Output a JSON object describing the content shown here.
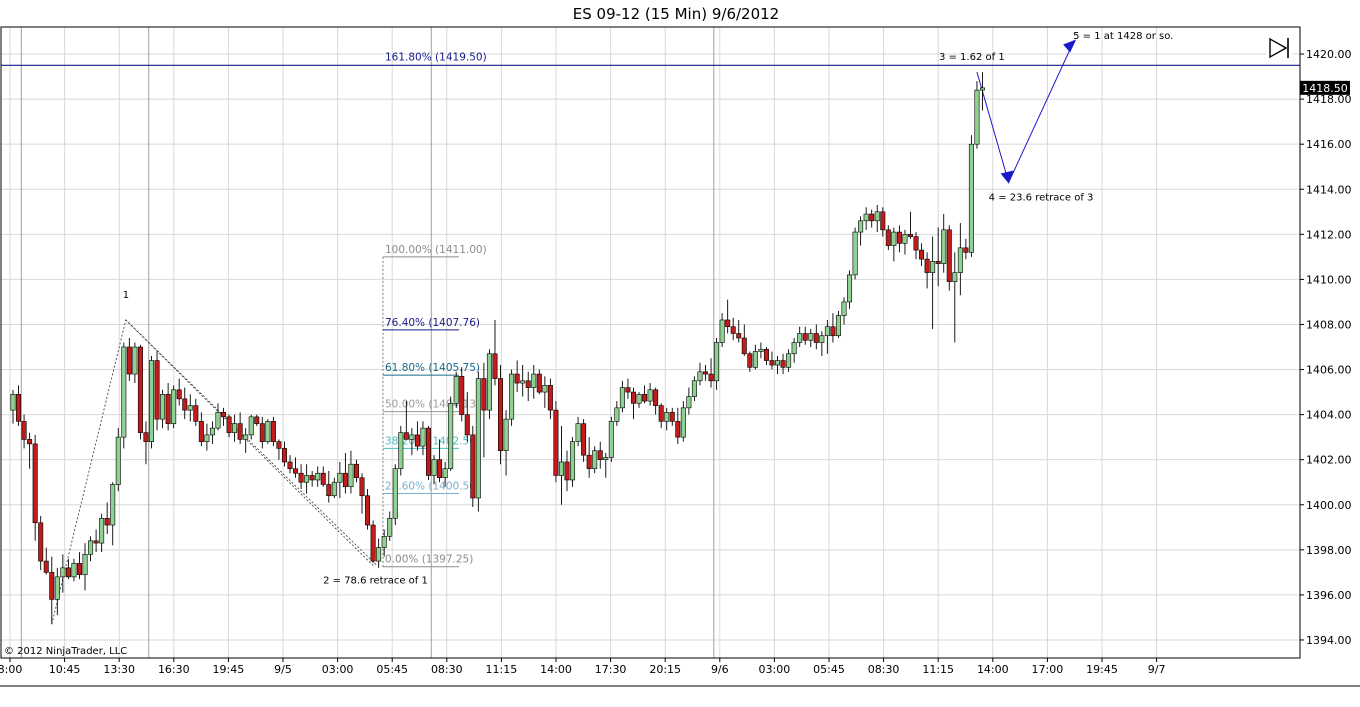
{
  "window": {
    "title": "ES 09-12 (15 Min)  9/6/2012",
    "copyright": "© 2012 NinjaTrader, LLC",
    "last_price_label": "1418.50",
    "colors": {
      "up_candle": "#90d090",
      "down_candle": "#c01c1c",
      "wick": "#000000",
      "grid": "#d8d8d8",
      "fib_line": "#8c8c8c",
      "blue_annotation": "#1a1acc",
      "price_marker_bg": "#000000"
    },
    "icons": [
      "skip-to-end-icon"
    ]
  },
  "chart_data": {
    "type": "candlestick",
    "symbol": "ES 09-12",
    "timeframe": "15 Min",
    "ylim": [
      1393.2,
      1421.2
    ],
    "y_ticks": [
      1394,
      1396,
      1398,
      1400,
      1402,
      1404,
      1406,
      1408,
      1410,
      1412,
      1414,
      1416,
      1418,
      1420
    ],
    "y_tick_labels": [
      "1394.00",
      "1396.00",
      "1398.00",
      "1400.00",
      "1402.00",
      "1404.00",
      "1406.00",
      "1408.00",
      "1410.00",
      "1412.00",
      "1414.00",
      "1416.00",
      "1418.00",
      "1420.00"
    ],
    "x_labels": [
      "8:00",
      "10:45",
      "13:30",
      "16:30",
      "19:45",
      "9/5",
      "03:00",
      "05:45",
      "08:30",
      "11:15",
      "14:00",
      "17:30",
      "20:15",
      "9/6",
      "03:00",
      "05:45",
      "08:30",
      "11:15",
      "14:00",
      "17:00",
      "19:45",
      "9/7"
    ],
    "session_dividers": [
      2,
      25,
      76,
      127
    ],
    "last_price": 1418.5,
    "candles": [
      [
        1404.2,
        1405.1,
        1403.6,
        1404.9
      ],
      [
        1404.9,
        1405.3,
        1403.5,
        1403.7
      ],
      [
        1403.7,
        1404.0,
        1402.5,
        1402.9
      ],
      [
        1402.9,
        1403.2,
        1401.6,
        1402.7
      ],
      [
        1402.7,
        1403.1,
        1398.4,
        1399.2
      ],
      [
        1399.2,
        1399.5,
        1397.1,
        1397.5
      ],
      [
        1397.5,
        1398.1,
        1396.9,
        1397.0
      ],
      [
        1397.0,
        1397.7,
        1394.7,
        1395.8
      ],
      [
        1395.8,
        1397.2,
        1395.1,
        1396.8
      ],
      [
        1396.8,
        1397.8,
        1396.1,
        1397.2
      ],
      [
        1397.2,
        1397.6,
        1396.7,
        1396.8
      ],
      [
        1396.8,
        1397.6,
        1396.6,
        1397.4
      ],
      [
        1397.4,
        1397.9,
        1396.7,
        1396.9
      ],
      [
        1396.9,
        1398.3,
        1396.2,
        1397.8
      ],
      [
        1397.8,
        1398.6,
        1397.5,
        1398.4
      ],
      [
        1398.4,
        1398.9,
        1397.9,
        1398.3
      ],
      [
        1398.3,
        1399.6,
        1397.9,
        1399.4
      ],
      [
        1399.4,
        1400.1,
        1398.7,
        1399.1
      ],
      [
        1399.1,
        1401.0,
        1398.2,
        1400.9
      ],
      [
        1400.9,
        1403.4,
        1400.6,
        1403.0
      ],
      [
        1403.0,
        1407.2,
        1402.5,
        1407.0
      ],
      [
        1407.0,
        1407.4,
        1405.5,
        1405.8
      ],
      [
        1405.8,
        1407.2,
        1405.4,
        1407.0
      ],
      [
        1407.0,
        1407.1,
        1402.9,
        1403.2
      ],
      [
        1403.2,
        1403.7,
        1401.8,
        1402.8
      ],
      [
        1402.8,
        1406.6,
        1402.5,
        1406.4
      ],
      [
        1406.4,
        1406.8,
        1403.3,
        1403.8
      ],
      [
        1403.8,
        1405.1,
        1403.4,
        1404.9
      ],
      [
        1404.9,
        1405.4,
        1403.3,
        1403.6
      ],
      [
        1403.6,
        1405.3,
        1403.4,
        1405.1
      ],
      [
        1405.1,
        1405.6,
        1404.4,
        1404.7
      ],
      [
        1404.7,
        1405.2,
        1403.8,
        1404.2
      ],
      [
        1404.2,
        1404.9,
        1403.7,
        1404.4
      ],
      [
        1404.4,
        1404.7,
        1403.5,
        1403.7
      ],
      [
        1403.7,
        1404.1,
        1402.6,
        1402.8
      ],
      [
        1402.8,
        1403.6,
        1402.4,
        1403.1
      ],
      [
        1403.1,
        1403.7,
        1402.7,
        1403.4
      ],
      [
        1403.4,
        1404.5,
        1403.3,
        1404.1
      ],
      [
        1404.1,
        1404.3,
        1403.5,
        1403.9
      ],
      [
        1403.9,
        1404.0,
        1403.0,
        1403.2
      ],
      [
        1403.2,
        1404.0,
        1402.8,
        1403.6
      ],
      [
        1403.6,
        1404.1,
        1402.7,
        1402.9
      ],
      [
        1402.9,
        1403.4,
        1402.3,
        1403.1
      ],
      [
        1403.1,
        1404.0,
        1402.9,
        1403.9
      ],
      [
        1403.9,
        1404.0,
        1403.5,
        1403.6
      ],
      [
        1403.6,
        1403.9,
        1402.5,
        1402.8
      ],
      [
        1402.8,
        1403.8,
        1402.7,
        1403.7
      ],
      [
        1403.7,
        1403.9,
        1402.6,
        1402.8
      ],
      [
        1402.8,
        1402.9,
        1402.0,
        1402.5
      ],
      [
        1402.5,
        1402.8,
        1401.7,
        1401.9
      ],
      [
        1401.9,
        1402.2,
        1401.4,
        1401.6
      ],
      [
        1401.6,
        1402.1,
        1401.2,
        1401.4
      ],
      [
        1401.4,
        1401.8,
        1400.7,
        1401.0
      ],
      [
        1401.0,
        1401.8,
        1400.5,
        1401.3
      ],
      [
        1401.3,
        1401.5,
        1400.8,
        1401.1
      ],
      [
        1401.1,
        1401.7,
        1400.8,
        1401.4
      ],
      [
        1401.4,
        1401.7,
        1400.8,
        1400.9
      ],
      [
        1400.9,
        1401.5,
        1400.1,
        1400.4
      ],
      [
        1400.4,
        1401.2,
        1400.3,
        1401.0
      ],
      [
        1401.0,
        1401.9,
        1400.3,
        1401.4
      ],
      [
        1401.4,
        1402.3,
        1400.5,
        1400.8
      ],
      [
        1400.8,
        1402.4,
        1400.5,
        1401.8
      ],
      [
        1401.8,
        1402.0,
        1401.0,
        1401.2
      ],
      [
        1401.2,
        1401.4,
        1399.6,
        1400.4
      ],
      [
        1400.4,
        1400.7,
        1398.9,
        1399.1
      ],
      [
        1399.1,
        1399.3,
        1397.4,
        1397.5
      ],
      [
        1397.5,
        1398.5,
        1397.2,
        1398.1
      ],
      [
        1398.1,
        1398.9,
        1397.7,
        1398.6
      ],
      [
        1398.6,
        1399.7,
        1398.4,
        1399.4
      ],
      [
        1399.4,
        1401.8,
        1399.1,
        1401.6
      ],
      [
        1401.6,
        1403.5,
        1401.3,
        1403.2
      ],
      [
        1403.2,
        1404.6,
        1403.0,
        1402.9
      ],
      [
        1402.9,
        1403.4,
        1402.2,
        1403.1
      ],
      [
        1403.1,
        1403.7,
        1402.4,
        1402.6
      ],
      [
        1402.6,
        1403.7,
        1402.2,
        1403.4
      ],
      [
        1403.4,
        1403.5,
        1401.1,
        1401.3
      ],
      [
        1401.3,
        1402.2,
        1400.9,
        1402.0
      ],
      [
        1402.0,
        1402.9,
        1401.0,
        1401.2
      ],
      [
        1401.2,
        1401.9,
        1400.8,
        1401.6
      ],
      [
        1401.6,
        1404.8,
        1401.5,
        1404.5
      ],
      [
        1404.5,
        1405.9,
        1404.3,
        1405.7
      ],
      [
        1405.7,
        1406.1,
        1403.7,
        1404.0
      ],
      [
        1404.0,
        1405.0,
        1402.8,
        1403.1
      ],
      [
        1403.1,
        1403.5,
        1399.9,
        1400.3
      ],
      [
        1400.3,
        1405.9,
        1399.7,
        1405.6
      ],
      [
        1405.6,
        1406.3,
        1402.1,
        1404.2
      ],
      [
        1404.2,
        1406.9,
        1403.8,
        1406.7
      ],
      [
        1406.7,
        1408.2,
        1405.3,
        1405.6
      ],
      [
        1405.6,
        1406.2,
        1401.8,
        1402.4
      ],
      [
        1402.4,
        1404.2,
        1401.3,
        1403.8
      ],
      [
        1403.8,
        1406.0,
        1403.5,
        1405.8
      ],
      [
        1405.8,
        1406.4,
        1405.0,
        1405.4
      ],
      [
        1405.4,
        1406.2,
        1404.8,
        1405.5
      ],
      [
        1405.5,
        1405.9,
        1404.6,
        1405.2
      ],
      [
        1405.2,
        1406.2,
        1404.7,
        1405.8
      ],
      [
        1405.8,
        1406.0,
        1404.9,
        1405.0
      ],
      [
        1405.0,
        1405.7,
        1404.3,
        1405.3
      ],
      [
        1405.3,
        1405.6,
        1403.8,
        1404.2
      ],
      [
        1404.2,
        1404.6,
        1401.0,
        1401.3
      ],
      [
        1401.3,
        1403.5,
        1400.0,
        1401.9
      ],
      [
        1401.9,
        1402.4,
        1400.6,
        1401.1
      ],
      [
        1401.1,
        1403.0,
        1400.8,
        1402.8
      ],
      [
        1402.8,
        1403.9,
        1402.6,
        1403.6
      ],
      [
        1403.6,
        1403.8,
        1401.9,
        1402.2
      ],
      [
        1402.2,
        1403.0,
        1401.2,
        1401.6
      ],
      [
        1401.6,
        1402.6,
        1401.4,
        1402.4
      ],
      [
        1402.4,
        1402.8,
        1401.6,
        1402.0
      ],
      [
        1402.0,
        1402.3,
        1401.2,
        1402.1
      ],
      [
        1402.1,
        1403.9,
        1401.9,
        1403.7
      ],
      [
        1403.7,
        1404.6,
        1403.5,
        1404.3
      ],
      [
        1404.3,
        1405.5,
        1404.1,
        1405.2
      ],
      [
        1405.2,
        1405.6,
        1404.7,
        1405.0
      ],
      [
        1405.0,
        1405.2,
        1403.8,
        1404.5
      ],
      [
        1404.5,
        1405.0,
        1404.3,
        1404.9
      ],
      [
        1404.9,
        1405.3,
        1404.5,
        1404.6
      ],
      [
        1404.6,
        1405.4,
        1404.4,
        1405.1
      ],
      [
        1405.1,
        1405.2,
        1404.0,
        1404.4
      ],
      [
        1404.4,
        1404.5,
        1403.4,
        1403.7
      ],
      [
        1403.7,
        1404.3,
        1403.3,
        1404.1
      ],
      [
        1404.1,
        1404.3,
        1403.5,
        1403.7
      ],
      [
        1403.7,
        1404.3,
        1402.7,
        1403.0
      ],
      [
        1403.0,
        1404.6,
        1402.8,
        1404.3
      ],
      [
        1404.3,
        1405.2,
        1404.0,
        1404.8
      ],
      [
        1404.8,
        1405.7,
        1404.6,
        1405.5
      ],
      [
        1405.5,
        1406.3,
        1405.3,
        1405.9
      ],
      [
        1405.9,
        1406.2,
        1405.5,
        1405.8
      ],
      [
        1405.8,
        1406.5,
        1405.2,
        1405.5
      ],
      [
        1405.5,
        1407.4,
        1405.1,
        1407.2
      ],
      [
        1407.2,
        1408.5,
        1407.0,
        1408.2
      ],
      [
        1408.2,
        1409.1,
        1407.6,
        1407.9
      ],
      [
        1407.9,
        1408.3,
        1407.3,
        1407.6
      ],
      [
        1407.6,
        1408.2,
        1407.2,
        1407.4
      ],
      [
        1407.4,
        1408.0,
        1406.6,
        1406.7
      ],
      [
        1406.7,
        1406.8,
        1405.9,
        1406.1
      ],
      [
        1406.1,
        1407.1,
        1406.0,
        1406.8
      ],
      [
        1406.8,
        1407.2,
        1406.5,
        1406.9
      ],
      [
        1406.9,
        1407.0,
        1406.2,
        1406.4
      ],
      [
        1406.4,
        1406.8,
        1406.0,
        1406.2
      ],
      [
        1406.2,
        1406.6,
        1405.8,
        1406.4
      ],
      [
        1406.4,
        1406.7,
        1405.8,
        1406.1
      ],
      [
        1406.1,
        1406.9,
        1405.9,
        1406.7
      ],
      [
        1406.7,
        1407.4,
        1406.3,
        1407.2
      ],
      [
        1407.2,
        1407.9,
        1407.0,
        1407.6
      ],
      [
        1407.6,
        1407.9,
        1407.1,
        1407.3
      ],
      [
        1407.3,
        1407.8,
        1407.0,
        1407.6
      ],
      [
        1407.6,
        1408.0,
        1406.9,
        1407.2
      ],
      [
        1407.2,
        1407.7,
        1406.6,
        1407.5
      ],
      [
        1407.5,
        1408.2,
        1406.7,
        1407.9
      ],
      [
        1407.9,
        1408.5,
        1407.2,
        1407.5
      ],
      [
        1407.5,
        1408.6,
        1407.4,
        1408.4
      ],
      [
        1408.4,
        1409.2,
        1408.0,
        1409.0
      ],
      [
        1409.0,
        1410.4,
        1408.7,
        1410.2
      ],
      [
        1410.2,
        1412.3,
        1410.0,
        1412.1
      ],
      [
        1412.1,
        1412.8,
        1411.5,
        1412.6
      ],
      [
        1412.6,
        1413.2,
        1412.2,
        1412.9
      ],
      [
        1412.9,
        1413.1,
        1412.3,
        1412.6
      ],
      [
        1412.6,
        1413.3,
        1412.1,
        1413.0
      ],
      [
        1413.0,
        1413.2,
        1411.9,
        1412.2
      ],
      [
        1412.2,
        1412.4,
        1411.3,
        1411.5
      ],
      [
        1411.5,
        1412.3,
        1410.8,
        1412.1
      ],
      [
        1412.1,
        1412.4,
        1411.2,
        1411.6
      ],
      [
        1411.6,
        1412.2,
        1411.1,
        1412.0
      ],
      [
        1412.0,
        1413.0,
        1411.8,
        1411.9
      ],
      [
        1411.9,
        1412.1,
        1410.9,
        1411.3
      ],
      [
        1411.3,
        1411.6,
        1410.6,
        1410.9
      ],
      [
        1410.9,
        1411.2,
        1409.6,
        1410.3
      ],
      [
        1410.3,
        1411.9,
        1407.8,
        1410.8
      ],
      [
        1410.8,
        1412.3,
        1409.7,
        1410.7
      ],
      [
        1410.7,
        1412.9,
        1410.3,
        1412.2
      ],
      [
        1412.2,
        1412.4,
        1409.5,
        1409.9
      ],
      [
        1409.9,
        1411.2,
        1407.2,
        1410.3
      ],
      [
        1410.3,
        1412.5,
        1409.3,
        1411.4
      ],
      [
        1411.4,
        1411.8,
        1410.9,
        1411.2
      ],
      [
        1411.2,
        1416.4,
        1411.0,
        1416.0
      ],
      [
        1416.0,
        1418.8,
        1415.8,
        1418.4
      ],
      [
        1418.4,
        1419.2,
        1417.5,
        1418.5
      ]
    ],
    "fibonacci": {
      "levels": [
        {
          "label": "161.80% (1419.50)",
          "price": 1419.5
        },
        {
          "label": "100.00% (1411.00)",
          "price": 1411.0
        },
        {
          "label": "76.40% (1407.76)",
          "price": 1407.76
        },
        {
          "label": "61.80% (1405.75)",
          "price": 1405.75
        },
        {
          "label": "50.00% (1404.13)",
          "price": 1404.13
        },
        {
          "label": "38.20% (1402.50)",
          "price": 1402.5
        },
        {
          "label": "23.60% (1400.50)",
          "price": 1400.5
        },
        {
          "label": "0.00% (1397.25)",
          "price": 1397.25
        }
      ]
    },
    "annotations": [
      {
        "text": "1",
        "candle": 20,
        "price": 1408.2
      },
      {
        "text": "2 = 78.6 retrace of 1",
        "candle": 65,
        "price": 1397.3
      },
      {
        "text": "3 = 1.62 of 1",
        "candle": 174,
        "price": 1419.2
      },
      {
        "text": "4 = 23.6 retrace of 3",
        "candle": 179,
        "price": 1414.3
      },
      {
        "text": "5 = 1 at 1428 or so.",
        "candle": 191,
        "price": 1420.4
      }
    ]
  }
}
